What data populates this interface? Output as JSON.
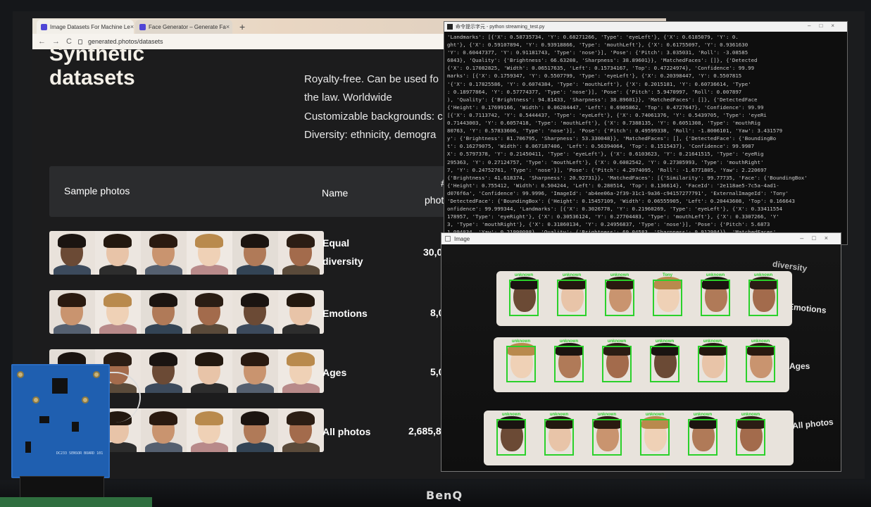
{
  "browser": {
    "tabs": [
      {
        "label": "Image Datasets For Machine Le",
        "close": "×"
      },
      {
        "label": "Face Generator – Generate Fa",
        "close": "×"
      }
    ],
    "new_tab": "+",
    "nav": [
      "←",
      "→",
      "C"
    ],
    "url": "generated.photos/datasets"
  },
  "page": {
    "hero_title_line1": "Synthetic",
    "hero_title_line2": "datasets",
    "features": [
      "Royalty-free. Can be used fo",
      "the law. Worldwide",
      "Customizable backgrounds: c",
      "Diversity: ethnicity, demogra"
    ],
    "table": {
      "col_sample": "Sample photos",
      "col_name": "Name",
      "col_count_line1": "#",
      "col_count_line2": "phot",
      "rows": [
        {
          "name_line1": "Equal",
          "name_line2": "diversity",
          "count": "30,0"
        },
        {
          "name_line1": "Emotions",
          "name_line2": "",
          "count": "8,0"
        },
        {
          "name_line1": "Ages",
          "name_line2": "",
          "count": "5,0"
        },
        {
          "name_line1": "All photos",
          "name_line2": "",
          "count": "2,685,8"
        }
      ]
    }
  },
  "terminal": {
    "title": "命令提示字元 - python  streaming_test.py",
    "lines": [
      "'Landmarks': [{'X': 0.58735734, 'Y': 0.68271266, 'Type': 'eyeLeft'}, {'X': 0.6185079, 'Y': 0.",
      "ght'}, {'X': 0.59107894, 'Y': 0.93918866, 'Type': 'mouthLeft'}, {'X': 0.61755097, 'Y': 0.9361630",
      "'Y': 0.60447377, 'Y': 0.91181743, 'Type': 'nose'}], 'Pose': {'Pitch': 3.035031, 'Roll': -3.08585",
      "6843}, 'Quality': {'Brightness': 66.63208, 'Sharpness': 38.89601}}, 'MatchedFaces': []}, {'Detected",
      "{'X': 0.17082825, 'Width': 0.06517635, 'Left': 0.15734167, 'Top': 0.47224974}, 'Confidence': 99.99",
      "marks': [{'X': 0.1759347, 'Y': 0.5507799, 'Type': 'eyeLeft'}, {'X': 0.20398447, 'Y': 0.5507815",
      "'{'X': 0.17825586, 'Y': 0.6074384, 'Type': 'mouthLeft'}, {'X': 0.2015181, 'Y': 0.60736614, 'Type'",
      ": 0.18977864, 'Y': 0.57774377, 'Type': 'nose'}], 'Pose': {'Pitch': 5.9470997, 'Roll': 0.007897",
      "), 'Quality': {'Brightness': 94.81433, 'Sharpness': 38.89601}}, 'MatchedFaces': []}, {'DetectedFace",
      "{'Height': 0.17699166, 'Width': 0.06284447, 'Left': 0.6905862, 'Top': 0.4727647}, 'Confidence': 99.99",
      "  [{'X': 0.7113742, 'Y': 0.5444437, 'Type': 'eyeLeft'}, {'X': 0.74061376, 'Y': 0.5439705, 'Type': 'eyeRi",
      "  0.71443003, 'Y': 0.6057418, 'Type': 'mouthLeft'}, {'X': 0.7388135, 'Y': 0.6051308, 'Type': 'mouthRig",
      "80763, 'Y': 0.57833606, 'Type': 'nose'}], 'Pose': {'Pitch': 0.49599338, 'Roll': -1.8006101, 'Yaw': 3.431579",
      "y': {'Brightness': 81.706795, 'Sharpness': 53.330048}}, 'MatchedFaces': [], {'DetectedFace': {'BoundingBo",
      "t': 0.16279075, 'Width': 0.067187406, 'Left': 0.56394064, 'Top': 0.1515437}, 'Confidence': 99.9987",
      "X': 0.5797378, 'Y': 0.21450411, 'Type': 'eyeLeft'}, {'X': 0.6103623, 'Y': 0.21641515, 'Type': 'eyeRig",
      "295363, 'Y': 0.27124757, 'Type': 'mouthLeft'}, {'X': 0.6082542, 'Y': 0.27305993, 'Type': 'mouthRight'",
      "7, 'Y': 0.24752761, 'Type': 'nose'}], 'Pose': {'Pitch': 4.2974095, 'Roll': -1.6771805, 'Yaw': 2.220697",
      "{'Brightness': 41.618374, 'Sharpness': 20.92731}}, 'MatchedFaces': [{'Similarity': 99.77735, 'Face': {'BoundingBox'",
      "{'Height': 0.755412, 'Width': 0.504244, 'Left': 0.280514, 'Top': 0.136614}, 'FaceId': '2e118ae5-7c5a-4ad1-",
      "d076f6a', 'Confidence': 99.9996, 'ImageId': 'ab4ee06a-2f39-31c1-9a36-c94157277791', 'ExternalImageId': 'Tony'",
      "'DetectedFace': {'BoundingBox': {'Height': 0.15457109, 'Width': 0.06555905, 'Left': 0.20443608, 'Top': 0.166643",
      "onfidence': 99.999344, 'Landmarks': [{'X': 0.3026778, 'Y': 0.21960269, 'Type': 'eyeLeft'}, {'X': 0.33411554",
      "178957, 'Type': 'eyeRight'}, {'X': 0.30536124, 'Y': 0.27704483, 'Type': 'mouthLeft'}, {'X': 0.3307266, 'Y'",
      "3, 'Type': 'mouthRight'}, {'X': 0.31860134, 'Y': 0.24956837, 'Type': 'nose'}], 'Pose': {'Pitch': 5.6873",
      "1.094034, 'Yaw': 0.21990098}, 'Quality': {'Brightness': 69.04583, 'Sharpness': 9.912904}}, 'MatchedFaces'",
      "ectedFace': {'BoundingBox': {'Height': 0.16327642, 'Width': 0.06104996, 'Left': 0.15488207, 'Top': 0.79",
      "idence': 99.999176, 'Landmarks': [{'X': 0.17330813, 'Y': 0.8659255, 'Type': 'eyeLeft'}, {'X': 0.2017754",
      "85, 'Type': 'eyeRight'}, {'X': 0.17427878, 'Y': 0.91918486, 'Type': 'mouthLeft'}, {'X': 0.19798739, 'Y'"
    ]
  },
  "viewer": {
    "title": "Image",
    "rows": [
      {
        "label": "Emotions",
        "top_label": "diversity",
        "tags": [
          "unknown",
          "unknown",
          "unknown",
          "Tony",
          "unknown",
          "unknown"
        ]
      },
      {
        "label": "Ages",
        "tags": [
          "unknown",
          "unknown",
          "unknown",
          "unknown",
          "unknown",
          "unknown"
        ]
      },
      {
        "label": "All photos",
        "tags": [
          "unknown",
          "unknown",
          "unknown",
          "unknown",
          "unknown",
          "unknown"
        ]
      }
    ]
  },
  "board": {
    "silk_text": "DC233 SENSOR BOARD 101"
  },
  "monitor": {
    "brand": "BenQ"
  },
  "colors": {
    "detect_box": "#2bd12b",
    "page_bg": "#1c1c1d",
    "board_blue": "#1f5fb0"
  }
}
